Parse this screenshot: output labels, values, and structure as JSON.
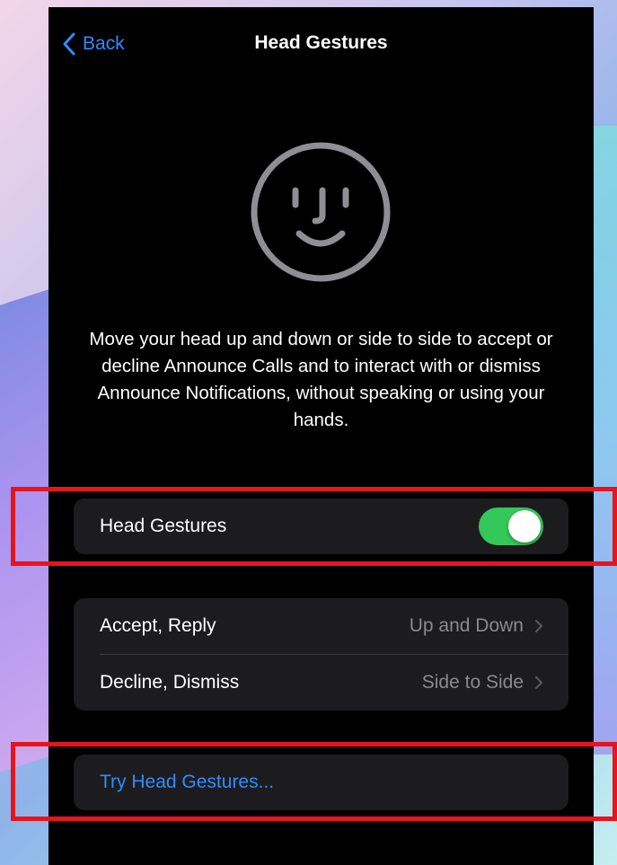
{
  "nav": {
    "back_label": "Back",
    "title": "Head Gestures"
  },
  "illustration": "face-icon",
  "description": "Move your head up and down or side to side to accept or decline Announce Calls and to interact with or dismiss Announce Notifications, without speaking or using your hands.",
  "toggle_row": {
    "label": "Head Gestures",
    "enabled": true
  },
  "gesture_rows": [
    {
      "label": "Accept, Reply",
      "value": "Up and Down"
    },
    {
      "label": "Decline, Dismiss",
      "value": "Side to Side"
    }
  ],
  "try_row": {
    "label": "Try Head Gestures..."
  },
  "colors": {
    "accent": "#2f8cff",
    "toggle_on": "#34c759",
    "highlight": "#e8141c",
    "cell_bg": "#1c1c1e"
  }
}
